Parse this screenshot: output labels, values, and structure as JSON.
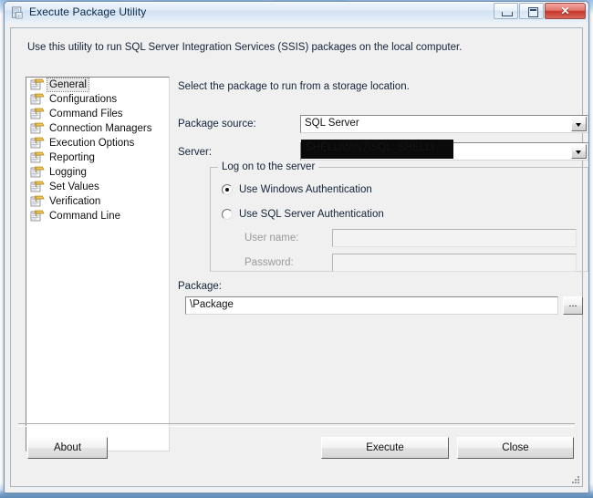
{
  "window": {
    "title": "Execute Package Utility",
    "icon": "package-document-icon",
    "controls": {
      "minimize_label": "Minimize",
      "maximize_label": "Maximize",
      "close_label": "✕"
    }
  },
  "header": {
    "description": "Use this utility to run SQL Server Integration Services (SSIS) packages on the local computer."
  },
  "sidebar": {
    "items": [
      {
        "label": "General",
        "selected": true
      },
      {
        "label": "Configurations",
        "selected": false
      },
      {
        "label": "Command Files",
        "selected": false
      },
      {
        "label": "Connection Managers",
        "selected": false
      },
      {
        "label": "Execution Options",
        "selected": false
      },
      {
        "label": "Reporting",
        "selected": false
      },
      {
        "label": "Logging",
        "selected": false
      },
      {
        "label": "Set Values",
        "selected": false
      },
      {
        "label": "Verification",
        "selected": false
      },
      {
        "label": "Command Line",
        "selected": false
      }
    ]
  },
  "pane": {
    "description": "Select the package to run from a storage location.",
    "package_source": {
      "label": "Package source:",
      "value": "SQL Server"
    },
    "server": {
      "label": "Server:",
      "value": "",
      "redacted_value": "SHELLIWIN7\\SQL_SHELLI"
    },
    "logon_group": {
      "title": "Log on to the server",
      "windows_auth": {
        "label": "Use Windows Authentication",
        "checked": true
      },
      "sql_auth": {
        "label": "Use SQL Server Authentication",
        "checked": false
      },
      "user_name": {
        "label": "User name:",
        "value": "",
        "disabled": true
      },
      "password": {
        "label": "Password:",
        "value": "",
        "disabled": true
      }
    },
    "package": {
      "label": "Package:",
      "value": "\\Package",
      "browse_label": "..."
    }
  },
  "footer": {
    "about_label": "About",
    "execute_label": "Execute",
    "close_label": "Close"
  }
}
